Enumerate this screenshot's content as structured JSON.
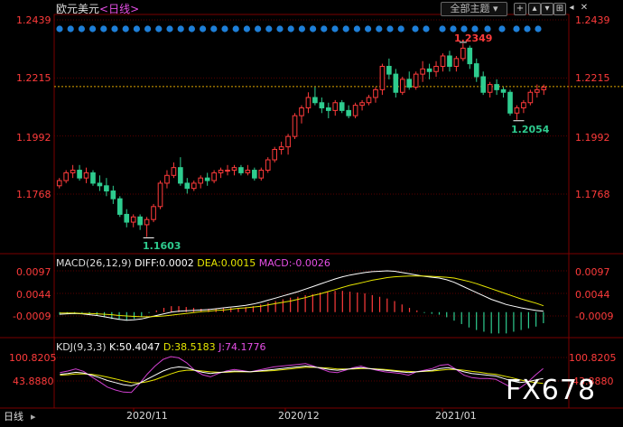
{
  "header": {
    "title": "欧元美元",
    "period": "<日线>",
    "theme_button": "全部主题",
    "theme_dropdown_icon": "chevron-down-icon",
    "icons": [
      "add-icon",
      "chevron-up-icon",
      "chevron-down-icon",
      "chart-icon",
      "chevron-left-icon",
      "close-icon"
    ]
  },
  "colors": {
    "up": "#ff3b3b",
    "down": "#2ecc8f",
    "price_line": "#e0a800",
    "dots": "#1e7fd8",
    "grid": "#5a0000",
    "diff": "#ffffff",
    "dea": "#e6e600",
    "j": "#d040d0"
  },
  "price_axis": {
    "left_labels": [
      "1.2439",
      "1.2215",
      "1.1992",
      "1.1768"
    ],
    "right_labels": [
      "1.2439",
      "1.2215",
      "1.1992",
      "1.1768"
    ],
    "values": [
      1.2439,
      1.2215,
      1.1992,
      1.1768
    ],
    "high_label": "1.2349",
    "low_label": "1.1603",
    "recent_low_label": "1.2054",
    "current_price": 1.2182
  },
  "macd": {
    "title": "MACD(26,12,9)",
    "diff_label": "DIFF:0.0002",
    "dea_label": "DEA:0.0015",
    "macd_label": "MACD:-0.0026",
    "axis_labels": [
      "0.0097",
      "0.0044",
      "-0.0009"
    ],
    "axis_values": [
      0.0097,
      0.0044,
      -0.0009
    ]
  },
  "kdj": {
    "title": "KDJ(9,3,3)",
    "k_label": "K:50.4047",
    "d_label": "D:38.5183",
    "j_label": "J:74.1776",
    "axis_labels": [
      "100.8205",
      "43.8880"
    ],
    "axis_values": [
      100.8205,
      43.888
    ]
  },
  "x_axis": {
    "labels": [
      "2020/11",
      "2020/12",
      "2021/01"
    ]
  },
  "bottom_tab": "日线",
  "watermark": "FX678",
  "chart_data": {
    "type": "candlestick",
    "series": [
      {
        "ohlc": [
          [
            1.18,
            1.183,
            1.179,
            1.182
          ],
          [
            1.182,
            1.186,
            1.181,
            1.185
          ],
          [
            1.185,
            1.188,
            1.183,
            1.186
          ],
          [
            1.186,
            1.188,
            1.182,
            1.183
          ],
          [
            1.183,
            1.187,
            1.181,
            1.185
          ],
          [
            1.185,
            1.186,
            1.18,
            1.181
          ],
          [
            1.181,
            1.184,
            1.178,
            1.18
          ],
          [
            1.18,
            1.183,
            1.176,
            1.178
          ],
          [
            1.178,
            1.18,
            1.173,
            1.175
          ],
          [
            1.175,
            1.176,
            1.168,
            1.169
          ],
          [
            1.169,
            1.171,
            1.164,
            1.166
          ],
          [
            1.166,
            1.169,
            1.164,
            1.168
          ],
          [
            1.168,
            1.169,
            1.163,
            1.165
          ],
          [
            1.165,
            1.168,
            1.1603,
            1.167
          ],
          [
            1.167,
            1.173,
            1.166,
            1.172
          ],
          [
            1.172,
            1.182,
            1.171,
            1.181
          ],
          [
            1.181,
            1.186,
            1.179,
            1.184
          ],
          [
            1.184,
            1.189,
            1.183,
            1.187
          ],
          [
            1.187,
            1.191,
            1.18,
            1.181
          ],
          [
            1.181,
            1.183,
            1.177,
            1.179
          ],
          [
            1.179,
            1.182,
            1.178,
            1.181
          ],
          [
            1.181,
            1.184,
            1.179,
            1.183
          ],
          [
            1.183,
            1.185,
            1.18,
            1.182
          ],
          [
            1.182,
            1.186,
            1.181,
            1.185
          ],
          [
            1.185,
            1.187,
            1.183,
            1.186
          ],
          [
            1.186,
            1.188,
            1.184,
            1.186
          ],
          [
            1.186,
            1.188,
            1.184,
            1.187
          ],
          [
            1.187,
            1.188,
            1.184,
            1.185
          ],
          [
            1.185,
            1.188,
            1.184,
            1.186
          ],
          [
            1.186,
            1.187,
            1.182,
            1.183
          ],
          [
            1.183,
            1.187,
            1.182,
            1.186
          ],
          [
            1.186,
            1.191,
            1.185,
            1.19
          ],
          [
            1.19,
            1.195,
            1.189,
            1.194
          ],
          [
            1.194,
            1.197,
            1.192,
            1.195
          ],
          [
            1.195,
            1.2,
            1.192,
            1.199
          ],
          [
            1.199,
            1.208,
            1.198,
            1.207
          ],
          [
            1.207,
            1.211,
            1.204,
            1.21
          ],
          [
            1.21,
            1.216,
            1.208,
            1.214
          ],
          [
            1.214,
            1.218,
            1.211,
            1.212
          ],
          [
            1.212,
            1.214,
            1.208,
            1.21
          ],
          [
            1.21,
            1.212,
            1.206,
            1.209
          ],
          [
            1.209,
            1.213,
            1.207,
            1.212
          ],
          [
            1.212,
            1.213,
            1.208,
            1.209
          ],
          [
            1.209,
            1.211,
            1.206,
            1.207
          ],
          [
            1.207,
            1.212,
            1.206,
            1.211
          ],
          [
            1.211,
            1.213,
            1.209,
            1.212
          ],
          [
            1.212,
            1.215,
            1.211,
            1.214
          ],
          [
            1.214,
            1.218,
            1.212,
            1.217
          ],
          [
            1.217,
            1.227,
            1.215,
            1.226
          ],
          [
            1.226,
            1.229,
            1.221,
            1.223
          ],
          [
            1.223,
            1.225,
            1.214,
            1.216
          ],
          [
            1.216,
            1.222,
            1.215,
            1.221
          ],
          [
            1.221,
            1.224,
            1.217,
            1.218
          ],
          [
            1.218,
            1.224,
            1.217,
            1.223
          ],
          [
            1.223,
            1.228,
            1.22,
            1.225
          ],
          [
            1.225,
            1.227,
            1.221,
            1.224
          ],
          [
            1.224,
            1.228,
            1.222,
            1.226
          ],
          [
            1.226,
            1.231,
            1.224,
            1.23
          ],
          [
            1.23,
            1.232,
            1.224,
            1.226
          ],
          [
            1.226,
            1.23,
            1.224,
            1.229
          ],
          [
            1.229,
            1.2349,
            1.228,
            1.233
          ],
          [
            1.233,
            1.234,
            1.225,
            1.227
          ],
          [
            1.227,
            1.229,
            1.22,
            1.222
          ],
          [
            1.222,
            1.224,
            1.215,
            1.216
          ],
          [
            1.216,
            1.22,
            1.214,
            1.219
          ],
          [
            1.219,
            1.221,
            1.215,
            1.217
          ],
          [
            1.217,
            1.218,
            1.214,
            1.216
          ],
          [
            1.216,
            1.217,
            1.207,
            1.208
          ],
          [
            1.208,
            1.211,
            1.2054,
            1.21
          ],
          [
            1.21,
            1.213,
            1.208,
            1.212
          ],
          [
            1.212,
            1.217,
            1.211,
            1.216
          ],
          [
            1.216,
            1.219,
            1.214,
            1.217
          ],
          [
            1.217,
            1.219,
            1.215,
            1.218
          ]
        ]
      }
    ],
    "macd_series": {
      "diff": [
        -0.0005,
        -0.0004,
        -0.0003,
        -0.0004,
        -0.0006,
        -0.0008,
        -0.0011,
        -0.0014,
        -0.0017,
        -0.0019,
        -0.0018,
        -0.0016,
        -0.0012,
        -0.0008,
        -0.0004,
        0.0,
        0.0002,
        0.0003,
        0.0004,
        0.0005,
        0.0006,
        0.0008,
        0.001,
        0.0012,
        0.0014,
        0.0016,
        0.0019,
        0.0023,
        0.0028,
        0.0033,
        0.0038,
        0.0043,
        0.0048,
        0.0054,
        0.006,
        0.0066,
        0.0072,
        0.0078,
        0.0083,
        0.0087,
        0.009,
        0.0093,
        0.0095,
        0.0096,
        0.0097,
        0.0096,
        0.0093,
        0.009,
        0.0087,
        0.0084,
        0.0082,
        0.008,
        0.0076,
        0.007,
        0.0062,
        0.0054,
        0.0046,
        0.0038,
        0.003,
        0.0024,
        0.0018,
        0.0014,
        0.001,
        0.0007,
        0.0004,
        0.0002
      ],
      "dea": [
        -0.0002,
        -0.0002,
        -0.0002,
        -0.0003,
        -0.0003,
        -0.0004,
        -0.0005,
        -0.0006,
        -0.0008,
        -0.0009,
        -0.001,
        -0.0011,
        -0.0011,
        -0.001,
        -0.0009,
        -0.0007,
        -0.0005,
        -0.0003,
        -0.0001,
        0.0001,
        0.0002,
        0.0004,
        0.0005,
        0.0007,
        0.0009,
        0.001,
        0.0012,
        0.0014,
        0.0017,
        0.002,
        0.0023,
        0.0026,
        0.003,
        0.0034,
        0.0039,
        0.0043,
        0.0048,
        0.0053,
        0.0058,
        0.0063,
        0.0067,
        0.0071,
        0.0075,
        0.0078,
        0.0081,
        0.0083,
        0.0084,
        0.0085,
        0.0085,
        0.0085,
        0.0084,
        0.0083,
        0.0082,
        0.008,
        0.0076,
        0.0072,
        0.0067,
        0.0061,
        0.0055,
        0.0049,
        0.0043,
        0.0037,
        0.0031,
        0.0026,
        0.0021,
        0.0015
      ]
    },
    "kdj_series": {
      "k": [
        60,
        62,
        65,
        63,
        58,
        52,
        45,
        40,
        35,
        32,
        38,
        48,
        58,
        68,
        75,
        78,
        76,
        70,
        65,
        62,
        64,
        66,
        68,
        67,
        66,
        68,
        70,
        72,
        74,
        76,
        78,
        80,
        78,
        75,
        72,
        70,
        72,
        74,
        76,
        74,
        72,
        70,
        68,
        66,
        64,
        66,
        68,
        70,
        74,
        76,
        72,
        66,
        62,
        60,
        58,
        56,
        50,
        44,
        40,
        42,
        46,
        50
      ],
      "d": [
        58,
        59,
        61,
        61,
        60,
        57,
        53,
        49,
        44,
        40,
        39,
        42,
        47,
        54,
        61,
        67,
        70,
        70,
        68,
        66,
        65,
        65,
        66,
        66,
        66,
        67,
        68,
        69,
        71,
        73,
        75,
        77,
        77,
        76,
        75,
        73,
        73,
        73,
        74,
        74,
        73,
        72,
        70,
        68,
        67,
        66,
        67,
        68,
        70,
        72,
        72,
        70,
        67,
        65,
        62,
        60,
        56,
        52,
        47,
        43,
        40,
        38
      ],
      "j": [
        64,
        68,
        73,
        67,
        54,
        42,
        29,
        22,
        17,
        16,
        36,
        60,
        80,
        96,
        103,
        100,
        88,
        70,
        59,
        54,
        62,
        68,
        72,
        69,
        66,
        70,
        74,
        78,
        80,
        82,
        84,
        86,
        80,
        73,
        66,
        64,
        70,
        76,
        80,
        74,
        70,
        66,
        64,
        62,
        58,
        66,
        70,
        74,
        82,
        84,
        72,
        58,
        52,
        50,
        50,
        48,
        38,
        28,
        26,
        40,
        58,
        74
      ]
    }
  }
}
